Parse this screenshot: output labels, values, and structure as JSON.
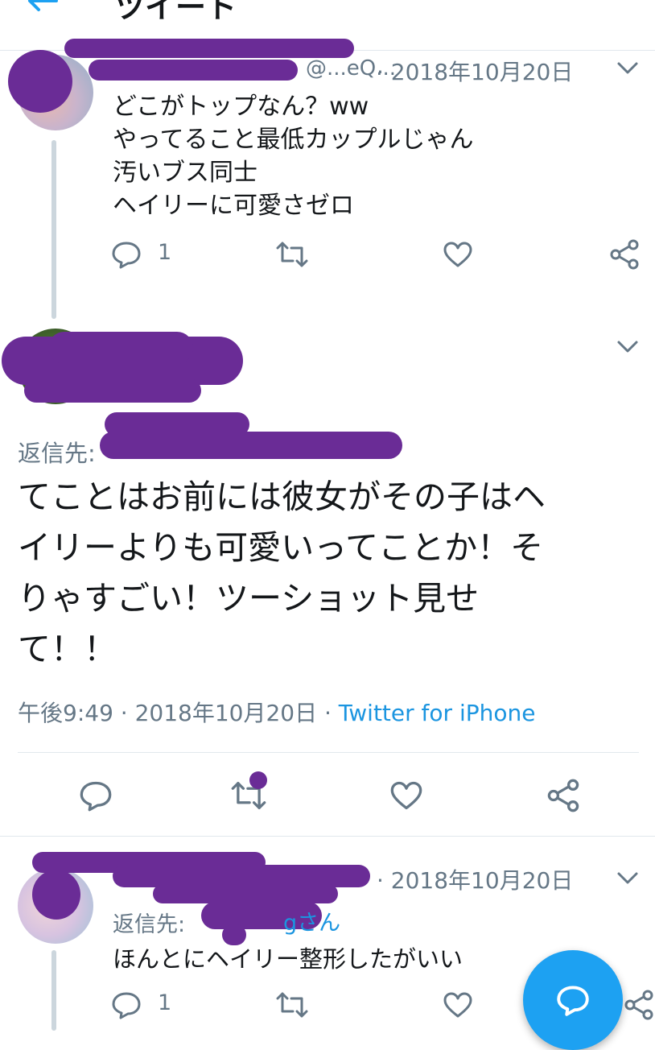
{
  "header": {
    "back_icon": "arrow-left-icon",
    "title": "ツイート",
    "accent": "#1da1f2"
  },
  "tweet1": {
    "handle": "@...eQ...",
    "date": "· 2018年10月20日",
    "lines": [
      "どこがトップなん？ww",
      "やってること最低カップルじゃん",
      "汚いブス同士",
      "ヘイリーに可愛さゼロ"
    ],
    "reply_count": "1"
  },
  "main_tweet": {
    "reply_to_label": "返信先:",
    "text_lines": [
      "てことはお前には彼女がその子はヘ",
      "イリーよりも可愛いってことか！そ",
      "りゃすごい！ツーショット見せ",
      "て！！"
    ],
    "time": "午後9:49 · 2018年10月20日 · ",
    "source": "Twitter for iPhone"
  },
  "tweet3": {
    "date": "· 2018年10月20日",
    "reply_to_label": "返信先:",
    "reply_to_suffix": "gさん",
    "text": "ほんとにヘイリー整形したがいい",
    "reply_count": "1"
  },
  "colors": {
    "scribble": "#6a2c96",
    "link": "#1b95e0",
    "fab": "#1da1f2"
  }
}
